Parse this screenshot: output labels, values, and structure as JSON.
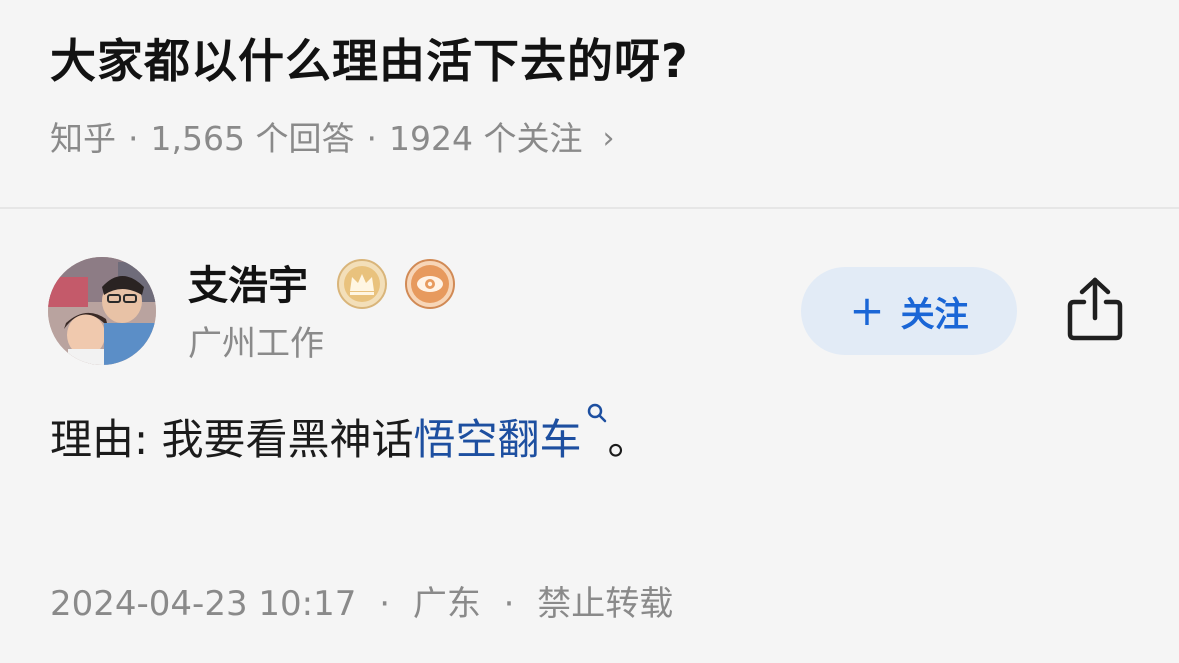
{
  "question": {
    "title": "大家都以什么理由活下去的呀?",
    "source": "知乎",
    "answers_count": "1,565 个回答",
    "followers_count": "1924 个关注",
    "separator": "·",
    "chevron": "›"
  },
  "author": {
    "name": "支浩宇",
    "headline": "广州工作",
    "badges": [
      "crown-badge-icon",
      "eye-badge-icon"
    ]
  },
  "follow_button": {
    "plus": "+",
    "label": "关注"
  },
  "answer": {
    "text_before": "理由:  我要看黑神话",
    "keyword": "悟空翻车",
    "text_after": "。"
  },
  "footer": {
    "datetime": "2024-04-23 10:17",
    "location": "广东",
    "copyright": "禁止转载",
    "separator": "·"
  },
  "colors": {
    "accent": "#1a66d6",
    "keyword": "#1d4fa0",
    "follow_bg": "#e2ebf6",
    "muted": "#8a8a8a",
    "background": "#f5f5f5"
  }
}
